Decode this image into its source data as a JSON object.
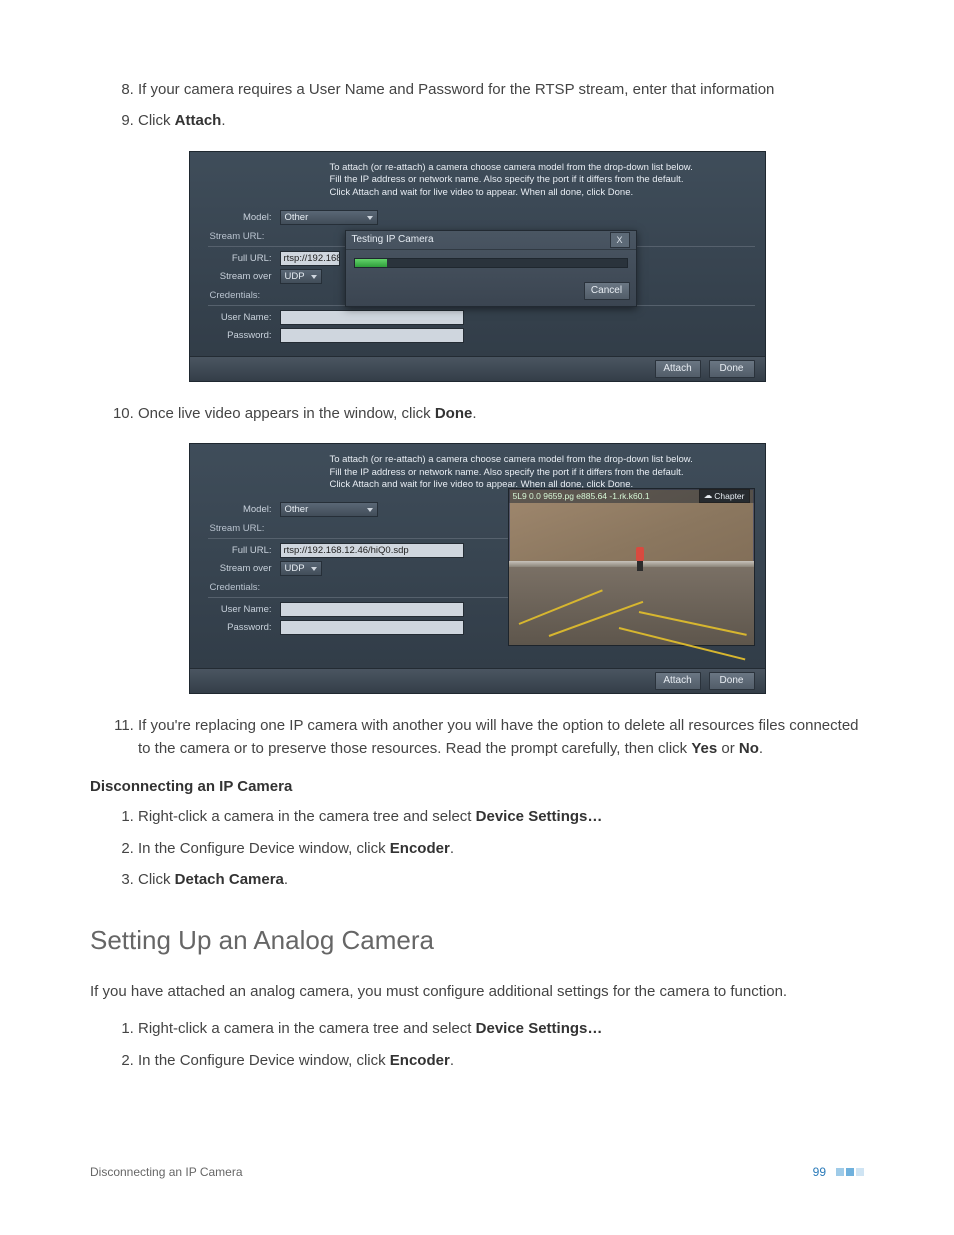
{
  "steps_a": {
    "s8": "If your camera requires a User Name and Password for the RTSP stream, enter that information",
    "s9_pre": "Click ",
    "s9_b": "Attach",
    "s9_post": "."
  },
  "shot1": {
    "instructions": "To attach (or re-attach) a camera choose camera model from the drop-down list below.\nFill the IP address or network name. Also specify the port if it differs from the default.\nClick Attach and wait for live video to appear. When all done, click Done.",
    "labels": {
      "model": "Model:",
      "stream_url": "Stream URL:",
      "full_url": "Full URL:",
      "stream_over": "Stream over",
      "credentials": "Credentials:",
      "user": "User Name:",
      "pass": "Password:"
    },
    "values": {
      "model": "Other",
      "full_url": "rtsp://192.168.12",
      "stream_over": "UDP"
    },
    "dialog": {
      "title": "Testing IP Camera",
      "cancel": "Cancel",
      "close": "X"
    },
    "footer": {
      "attach": "Attach",
      "done": "Done"
    }
  },
  "steps_b": {
    "s10_pre": "Once live video appears in the window, click ",
    "s10_b": "Done",
    "s10_post": "."
  },
  "shot2": {
    "instructions": "To attach (or re-attach) a camera choose camera model from the drop-down list below.\nFill the IP address or network name. Also specify the port if it differs from the default.\nClick Attach and wait for live video to appear. When all done, click Done.",
    "labels": {
      "model": "Model:",
      "stream_url": "Stream URL:",
      "full_url": "Full URL:",
      "stream_over": "Stream over",
      "credentials": "Credentials:",
      "user": "User Name:",
      "pass": "Password:"
    },
    "values": {
      "model": "Other",
      "full_url": "rtsp://192.168.12.46/hiQ0.sdp",
      "stream_over": "UDP"
    },
    "overlay_text": "5L9  0.0  9659.pg  e885.64 -1.rk.k60.1",
    "chapter": "Chapter",
    "footer": {
      "attach": "Attach",
      "done": "Done"
    }
  },
  "step11": {
    "pre": "If you're replacing one IP camera with another you will have the option to delete all resources files connected to the camera or to preserve those resources. Read the prompt carefully, then click ",
    "b1": "Yes",
    "mid": " or ",
    "b2": "No",
    "post": "."
  },
  "disconnect": {
    "heading": "Disconnecting an IP Camera",
    "s1_pre": "Right-click a camera in the camera tree and select ",
    "s1_b": "Device Settings…",
    "s2_pre": "In the Configure Device window, click ",
    "s2_b": "Encoder",
    "s2_post": ".",
    "s3_pre": "Click ",
    "s3_b": "Detach Camera",
    "s3_post": "."
  },
  "analog": {
    "heading": "Setting Up an Analog Camera",
    "intro": "If you have attached an analog camera, you must configure additional settings for the camera to function.",
    "s1_pre": "Right-click a camera in the camera tree and select ",
    "s1_b": "Device Settings…",
    "s2_pre": "In the Configure Device window, click ",
    "s2_b": "Encoder",
    "s2_post": "."
  },
  "page_footer": {
    "left": "Disconnecting an IP Camera",
    "num": "99"
  }
}
